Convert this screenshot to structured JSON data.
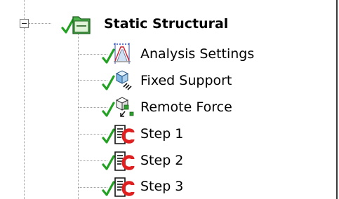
{
  "tree": {
    "root": {
      "label": "Static Structural",
      "expanded": true,
      "icon": "folder-icon",
      "status": "check-icon"
    },
    "children": [
      {
        "label": "Analysis Settings",
        "icon": "analysis-settings-icon",
        "status": "check-icon"
      },
      {
        "label": "Fixed Support",
        "icon": "fixed-support-icon",
        "status": "check-icon"
      },
      {
        "label": "Remote Force",
        "icon": "remote-force-icon",
        "status": "check-icon"
      },
      {
        "label": "Step 1",
        "icon": "step-command-icon",
        "status": "check-icon"
      },
      {
        "label": "Step 2",
        "icon": "step-command-icon",
        "status": "check-icon"
      },
      {
        "label": "Step 3",
        "icon": "step-command-icon",
        "status": "check-icon"
      }
    ]
  },
  "colors": {
    "check": "#22a122",
    "folder_green": "#3faa3f",
    "command_red": "#e02020",
    "tree_line": "#9a9a9a",
    "right_border": "#3a3a3a"
  }
}
